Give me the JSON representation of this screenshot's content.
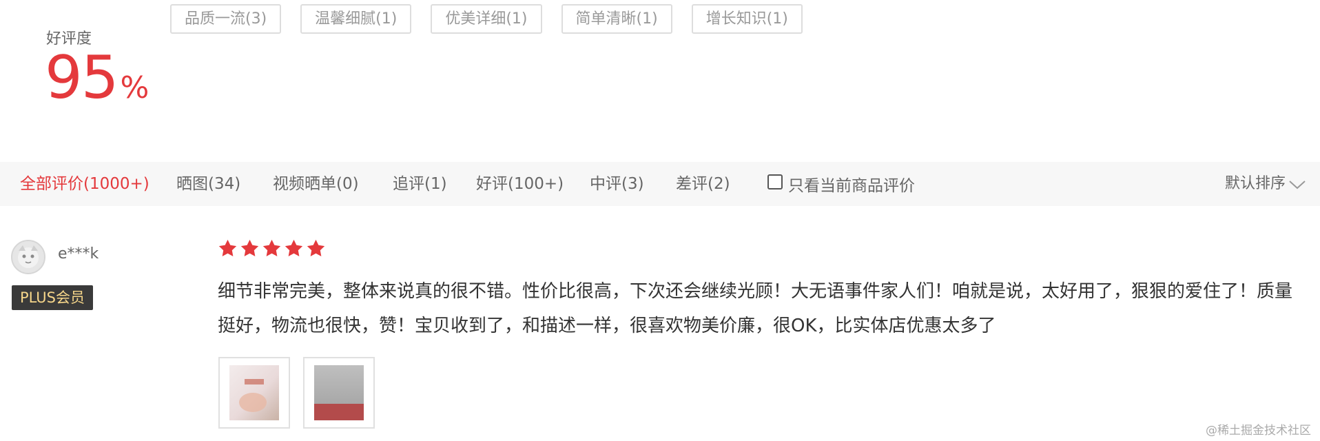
{
  "rating": {
    "label": "好评度",
    "value": "95",
    "unit": "%"
  },
  "tags": [
    "品质一流(3)",
    "温馨细腻(1)",
    "优美详细(1)",
    "简单清晰(1)",
    "增长知识(1)"
  ],
  "filters": {
    "all": "全部评价(1000+)",
    "with_images": "晒图(34)",
    "video": "视频晒单(0)",
    "followup": "追评(1)",
    "positive": "好评(100+)",
    "neutral": "中评(3)",
    "negative": "差评(2)",
    "only_current": "只看当前商品评价",
    "sort": "默认排序"
  },
  "review": {
    "username": "e***k",
    "badge": "PLUS会员",
    "stars": 5,
    "text": "细节非常完美，整体来说真的很不错。性价比很高，下次还会继续光顾！大无语事件家人们！咱就是说，太好用了，狠狠的爱住了！质量挺好，物流也很快，赞！宝贝收到了，和描述一样，很喜欢物美价廉，很OK，比实体店优惠太多了"
  },
  "watermark": "@稀土掘金技术社区",
  "colors": {
    "accent": "#e4393c",
    "filter_bg": "#f7f7f7",
    "badge_bg": "#3a3a3a",
    "badge_text": "#f6d68a"
  }
}
